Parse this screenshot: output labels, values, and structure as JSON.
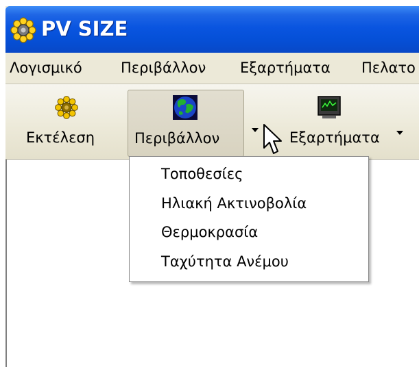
{
  "window": {
    "title": "PV SIZE",
    "title_icon": "sun-icon"
  },
  "menubar": {
    "items": [
      {
        "label": "Λογισμικό"
      },
      {
        "label": "Περιβάλλον"
      },
      {
        "label": "Εξαρτήματα"
      },
      {
        "label": "Πελατο"
      }
    ]
  },
  "toolbar": {
    "buttons": [
      {
        "label": "Εκτέλεση",
        "icon": "gear-icon"
      },
      {
        "label": "Περιβάλλον",
        "icon": "globe-icon",
        "state": "pressed",
        "has_dropdown": true
      },
      {
        "label": "Εξαρτήματα",
        "icon": "monitor-icon",
        "has_dropdown": true
      }
    ]
  },
  "dropdown": {
    "items": [
      {
        "label": "Τοποθεσίες"
      },
      {
        "label": "Ηλιακή Ακτινοβολία"
      },
      {
        "label": "Θερμοκρασία"
      },
      {
        "label": "Ταχύτητα Ανέμου"
      }
    ]
  },
  "colors": {
    "titlebar": "#0550d8",
    "window_face": "#ece9d8",
    "menu_background": "#ffffff"
  }
}
